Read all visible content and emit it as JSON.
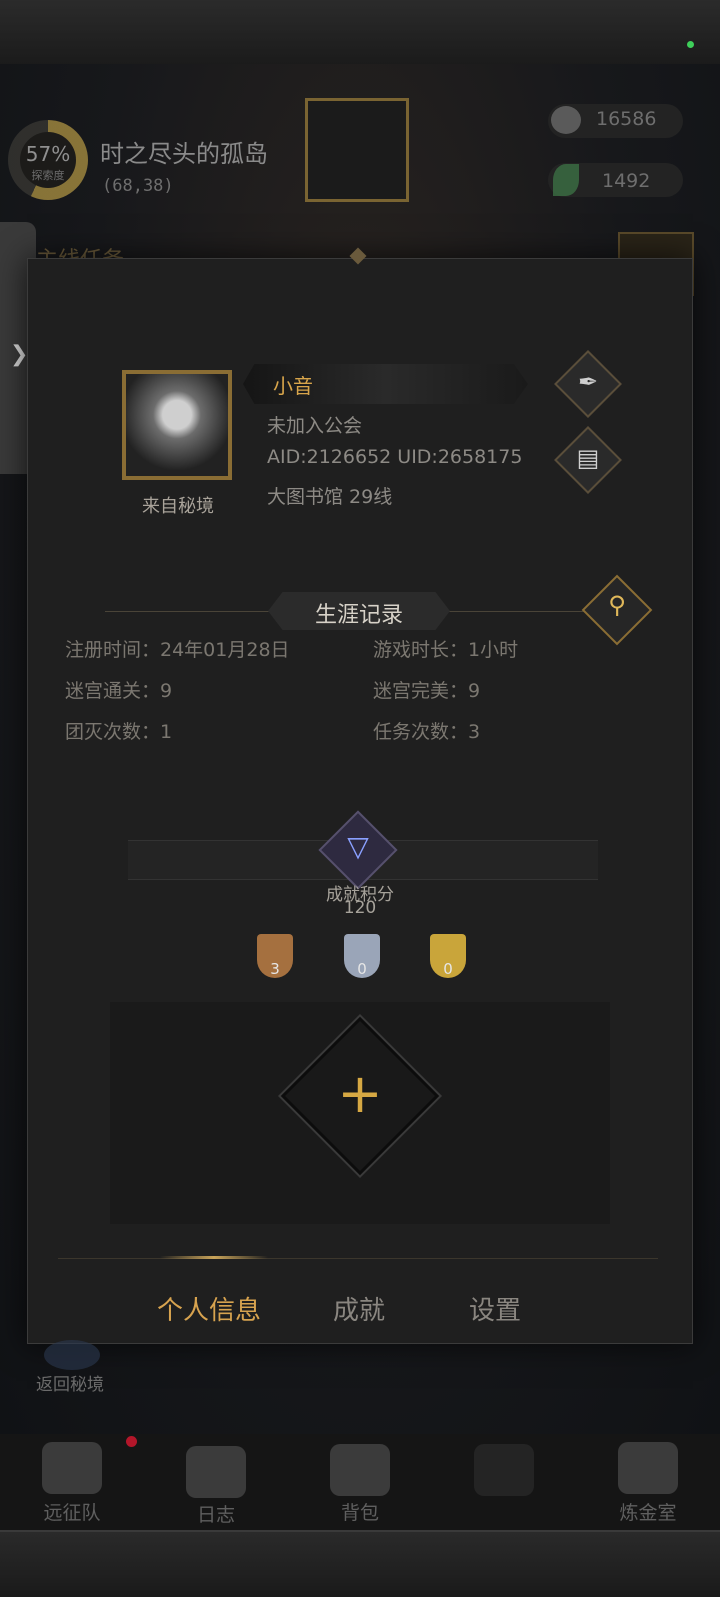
{
  "hud": {
    "explore_percent": "57%",
    "explore_label": "探索度",
    "map_title": "时之尽头的孤岛",
    "map_coord": "(68,38)",
    "resource_stone": "16586",
    "resource_leaf": "1492",
    "quest_label": "主线任务"
  },
  "profile": {
    "name": "小音",
    "guild_status": "未加入公会",
    "ids": "AID:2126652   UID:2658175",
    "server": "大图书馆 29线",
    "avatar_caption": "来自秘境"
  },
  "career": {
    "title": "生涯记录",
    "stats": [
      {
        "label": "注册时间：24年01月28日"
      },
      {
        "label": "游戏时长：1小时"
      },
      {
        "label": "迷宫通关：9"
      },
      {
        "label": "迷宫完美：9"
      },
      {
        "label": "团灭次数：1"
      },
      {
        "label": "任务次数：3"
      }
    ]
  },
  "achievement": {
    "score_label": "成就积分",
    "score_value": "120",
    "medals": [
      {
        "count": "3",
        "color": "#a5703f"
      },
      {
        "count": "0",
        "color": "#9aa5b8"
      },
      {
        "count": "0",
        "color": "#c9a53a"
      }
    ]
  },
  "tabs": [
    {
      "label": "个人信息",
      "active": true
    },
    {
      "label": "成就",
      "active": false
    },
    {
      "label": "设置",
      "active": false
    }
  ],
  "return_label": "返回秘境",
  "nav": [
    {
      "label": "远征队",
      "icon": "helmet-icon"
    },
    {
      "label": "日志",
      "icon": "scroll-icon"
    },
    {
      "label": "背包",
      "icon": "bag-icon"
    },
    {
      "label": "",
      "icon": "locked-icon"
    },
    {
      "label": "炼金室",
      "icon": "alchemy-icon"
    }
  ],
  "icons": {
    "edit": "feather-icon",
    "doc": "document-icon",
    "search": "magnifier-icon",
    "add": "plus-icon",
    "chevron": "chevron-right-icon"
  },
  "colors": {
    "accent": "#d7a34f",
    "panel": "#1f1f1f"
  }
}
